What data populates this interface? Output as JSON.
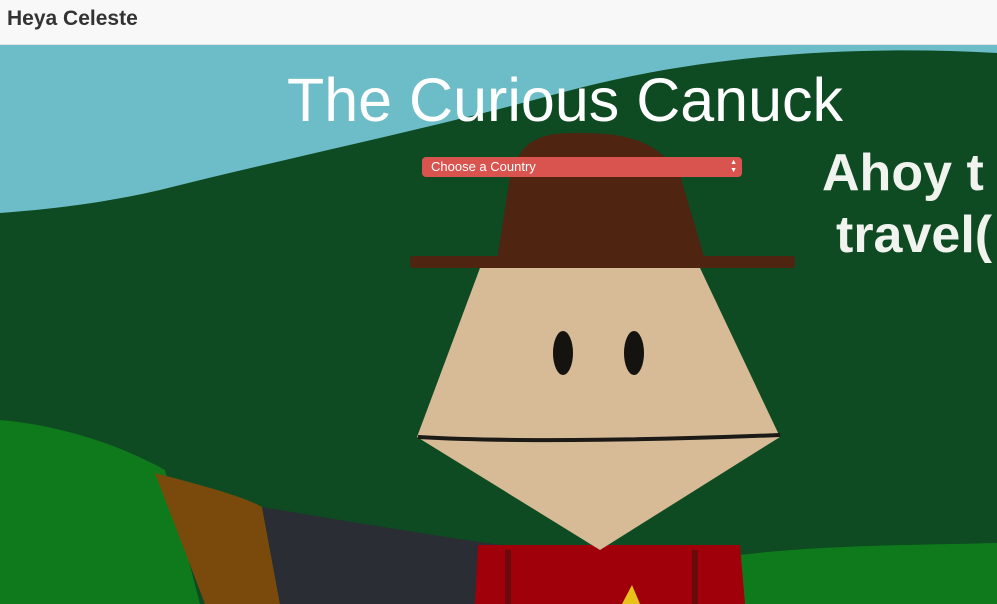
{
  "navbar": {
    "brand": "Heya Celeste"
  },
  "hero": {
    "title": "The Curious Canuck",
    "country_select": {
      "selected": "Choose a Country"
    },
    "background_text": [
      "Ahoy t",
      "travel("
    ],
    "colors": {
      "sky": "#6cbdc8",
      "hill": "#0e4a22",
      "grass": "#0f7a1c",
      "hat": "#4f2411",
      "face": "#d7bb97",
      "shirt": "#a0000a",
      "select": "#d9534f"
    }
  }
}
